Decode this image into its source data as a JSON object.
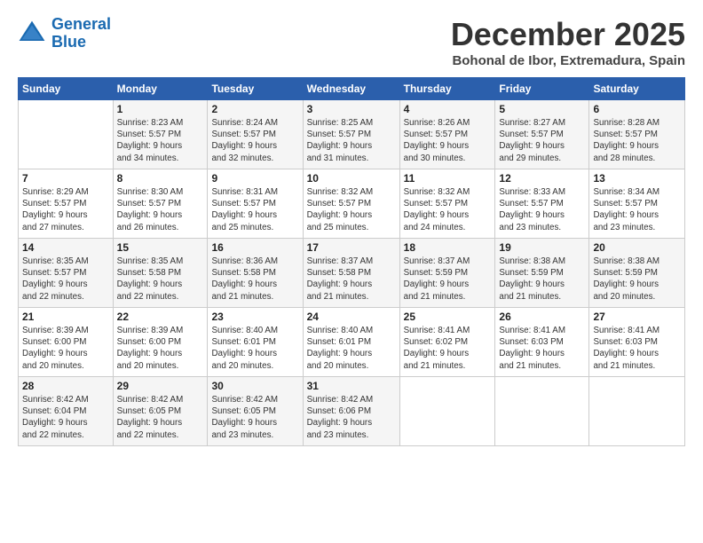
{
  "header": {
    "logo_line1": "General",
    "logo_line2": "Blue",
    "title": "December 2025",
    "subtitle": "Bohonal de Ibor, Extremadura, Spain"
  },
  "weekdays": [
    "Sunday",
    "Monday",
    "Tuesday",
    "Wednesday",
    "Thursday",
    "Friday",
    "Saturday"
  ],
  "weeks": [
    [
      {
        "day": "",
        "text": ""
      },
      {
        "day": "1",
        "text": "Sunrise: 8:23 AM\nSunset: 5:57 PM\nDaylight: 9 hours\nand 34 minutes."
      },
      {
        "day": "2",
        "text": "Sunrise: 8:24 AM\nSunset: 5:57 PM\nDaylight: 9 hours\nand 32 minutes."
      },
      {
        "day": "3",
        "text": "Sunrise: 8:25 AM\nSunset: 5:57 PM\nDaylight: 9 hours\nand 31 minutes."
      },
      {
        "day": "4",
        "text": "Sunrise: 8:26 AM\nSunset: 5:57 PM\nDaylight: 9 hours\nand 30 minutes."
      },
      {
        "day": "5",
        "text": "Sunrise: 8:27 AM\nSunset: 5:57 PM\nDaylight: 9 hours\nand 29 minutes."
      },
      {
        "day": "6",
        "text": "Sunrise: 8:28 AM\nSunset: 5:57 PM\nDaylight: 9 hours\nand 28 minutes."
      }
    ],
    [
      {
        "day": "7",
        "text": "Sunrise: 8:29 AM\nSunset: 5:57 PM\nDaylight: 9 hours\nand 27 minutes."
      },
      {
        "day": "8",
        "text": "Sunrise: 8:30 AM\nSunset: 5:57 PM\nDaylight: 9 hours\nand 26 minutes."
      },
      {
        "day": "9",
        "text": "Sunrise: 8:31 AM\nSunset: 5:57 PM\nDaylight: 9 hours\nand 25 minutes."
      },
      {
        "day": "10",
        "text": "Sunrise: 8:32 AM\nSunset: 5:57 PM\nDaylight: 9 hours\nand 25 minutes."
      },
      {
        "day": "11",
        "text": "Sunrise: 8:32 AM\nSunset: 5:57 PM\nDaylight: 9 hours\nand 24 minutes."
      },
      {
        "day": "12",
        "text": "Sunrise: 8:33 AM\nSunset: 5:57 PM\nDaylight: 9 hours\nand 23 minutes."
      },
      {
        "day": "13",
        "text": "Sunrise: 8:34 AM\nSunset: 5:57 PM\nDaylight: 9 hours\nand 23 minutes."
      }
    ],
    [
      {
        "day": "14",
        "text": "Sunrise: 8:35 AM\nSunset: 5:57 PM\nDaylight: 9 hours\nand 22 minutes."
      },
      {
        "day": "15",
        "text": "Sunrise: 8:35 AM\nSunset: 5:58 PM\nDaylight: 9 hours\nand 22 minutes."
      },
      {
        "day": "16",
        "text": "Sunrise: 8:36 AM\nSunset: 5:58 PM\nDaylight: 9 hours\nand 21 minutes."
      },
      {
        "day": "17",
        "text": "Sunrise: 8:37 AM\nSunset: 5:58 PM\nDaylight: 9 hours\nand 21 minutes."
      },
      {
        "day": "18",
        "text": "Sunrise: 8:37 AM\nSunset: 5:59 PM\nDaylight: 9 hours\nand 21 minutes."
      },
      {
        "day": "19",
        "text": "Sunrise: 8:38 AM\nSunset: 5:59 PM\nDaylight: 9 hours\nand 21 minutes."
      },
      {
        "day": "20",
        "text": "Sunrise: 8:38 AM\nSunset: 5:59 PM\nDaylight: 9 hours\nand 20 minutes."
      }
    ],
    [
      {
        "day": "21",
        "text": "Sunrise: 8:39 AM\nSunset: 6:00 PM\nDaylight: 9 hours\nand 20 minutes."
      },
      {
        "day": "22",
        "text": "Sunrise: 8:39 AM\nSunset: 6:00 PM\nDaylight: 9 hours\nand 20 minutes."
      },
      {
        "day": "23",
        "text": "Sunrise: 8:40 AM\nSunset: 6:01 PM\nDaylight: 9 hours\nand 20 minutes."
      },
      {
        "day": "24",
        "text": "Sunrise: 8:40 AM\nSunset: 6:01 PM\nDaylight: 9 hours\nand 20 minutes."
      },
      {
        "day": "25",
        "text": "Sunrise: 8:41 AM\nSunset: 6:02 PM\nDaylight: 9 hours\nand 21 minutes."
      },
      {
        "day": "26",
        "text": "Sunrise: 8:41 AM\nSunset: 6:03 PM\nDaylight: 9 hours\nand 21 minutes."
      },
      {
        "day": "27",
        "text": "Sunrise: 8:41 AM\nSunset: 6:03 PM\nDaylight: 9 hours\nand 21 minutes."
      }
    ],
    [
      {
        "day": "28",
        "text": "Sunrise: 8:42 AM\nSunset: 6:04 PM\nDaylight: 9 hours\nand 22 minutes."
      },
      {
        "day": "29",
        "text": "Sunrise: 8:42 AM\nSunset: 6:05 PM\nDaylight: 9 hours\nand 22 minutes."
      },
      {
        "day": "30",
        "text": "Sunrise: 8:42 AM\nSunset: 6:05 PM\nDaylight: 9 hours\nand 23 minutes."
      },
      {
        "day": "31",
        "text": "Sunrise: 8:42 AM\nSunset: 6:06 PM\nDaylight: 9 hours\nand 23 minutes."
      },
      {
        "day": "",
        "text": ""
      },
      {
        "day": "",
        "text": ""
      },
      {
        "day": "",
        "text": ""
      }
    ]
  ]
}
